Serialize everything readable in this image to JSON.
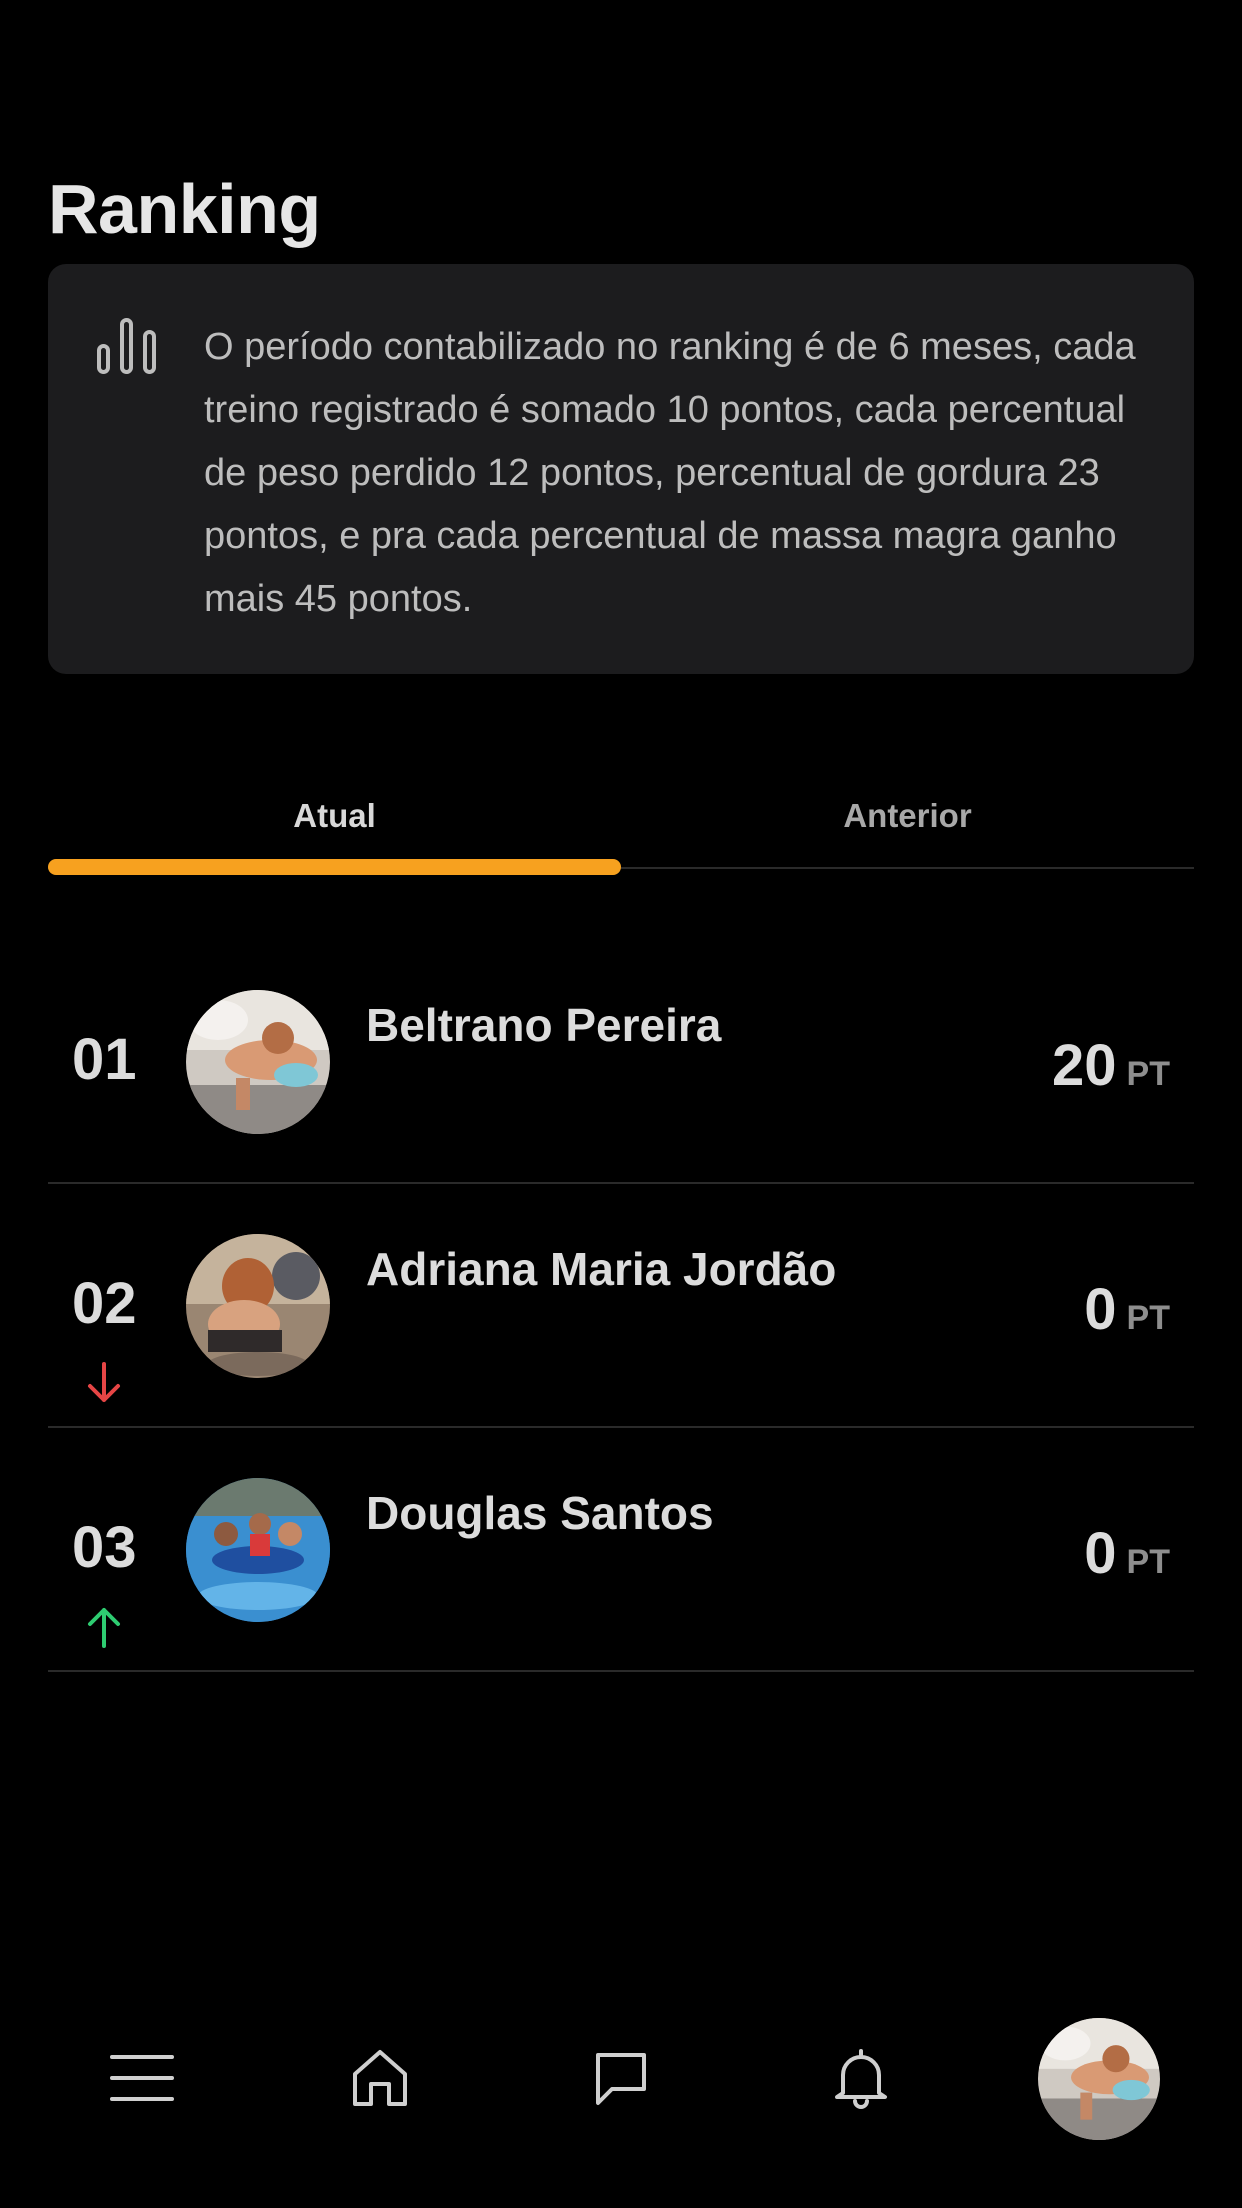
{
  "header": {
    "title": "Ranking"
  },
  "info": {
    "icon": "bar-chart-icon",
    "text": "O período contabilizado no ranking é de 6 meses, cada treino registrado é somado 10 pontos, cada percentual de peso perdido 12 pontos, percentual de gordura 23 pontos, e pra cada percentual de massa magra ganho mais 45 pontos."
  },
  "tabs": [
    {
      "label": "Atual",
      "active": true
    },
    {
      "label": "Anterior",
      "active": false
    }
  ],
  "colors": {
    "accent": "#f7a11f",
    "trend_down": "#e64545",
    "trend_up": "#2ecc71",
    "card_bg": "#1c1c1e",
    "page_bg": "#000000"
  },
  "ranking": [
    {
      "position": "01",
      "name": "Beltrano Pereira",
      "score": "20",
      "unit": "PT",
      "trend": "none"
    },
    {
      "position": "02",
      "name": "Adriana Maria Jordão",
      "score": "0",
      "unit": "PT",
      "trend": "down"
    },
    {
      "position": "03",
      "name": "Douglas Santos",
      "score": "0",
      "unit": "PT",
      "trend": "up"
    }
  ],
  "bottom_nav": [
    {
      "icon": "menu-icon"
    },
    {
      "icon": "home-icon"
    },
    {
      "icon": "chat-icon"
    },
    {
      "icon": "bell-icon"
    },
    {
      "icon": "profile-avatar"
    }
  ]
}
